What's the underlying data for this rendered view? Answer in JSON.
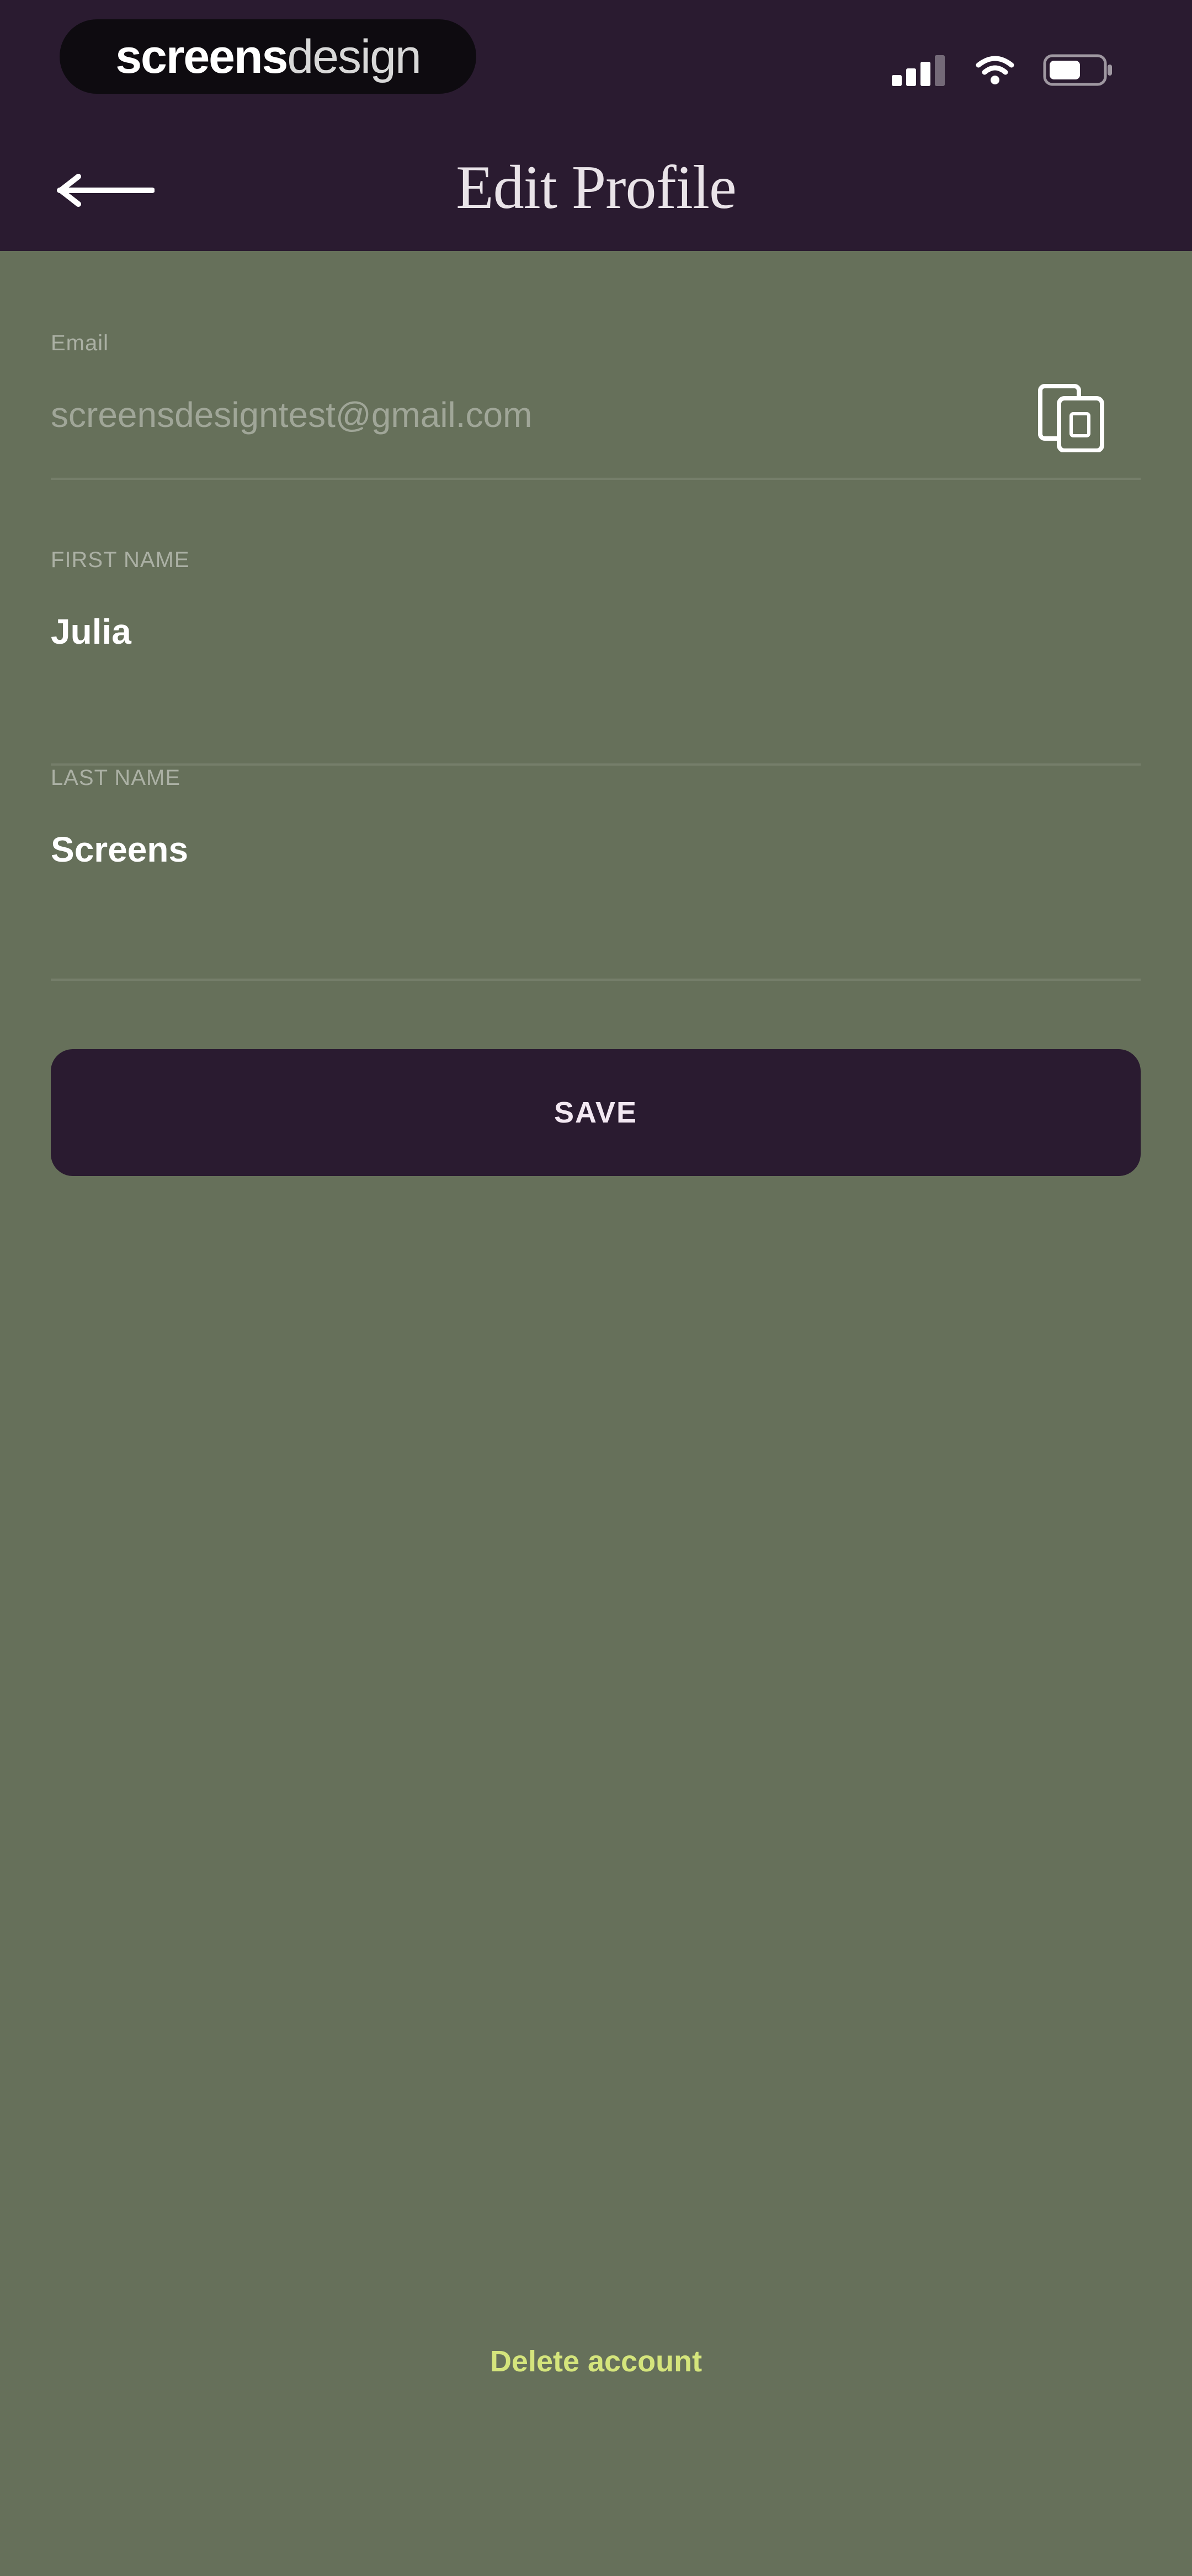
{
  "brand": {
    "strong": "screens",
    "light": "design"
  },
  "header": {
    "title": "Edit Profile"
  },
  "form": {
    "email": {
      "label": "Email",
      "value": "screensdesigntest@gmail.com"
    },
    "first_name": {
      "label": "FIRST NAME",
      "value": "Julia"
    },
    "last_name": {
      "label": "LAST NAME",
      "value": "Screens"
    }
  },
  "actions": {
    "save_label": "SAVE",
    "delete_label": "Delete account"
  },
  "colors": {
    "header_bg": "#2A1B30",
    "page_bg": "#66705A",
    "accent_text": "#D5E57C"
  },
  "icons": {
    "back": "arrow-left-icon",
    "copy": "copy-icon",
    "signal": "cellular-signal-icon",
    "wifi": "wifi-icon",
    "battery": "battery-icon"
  }
}
